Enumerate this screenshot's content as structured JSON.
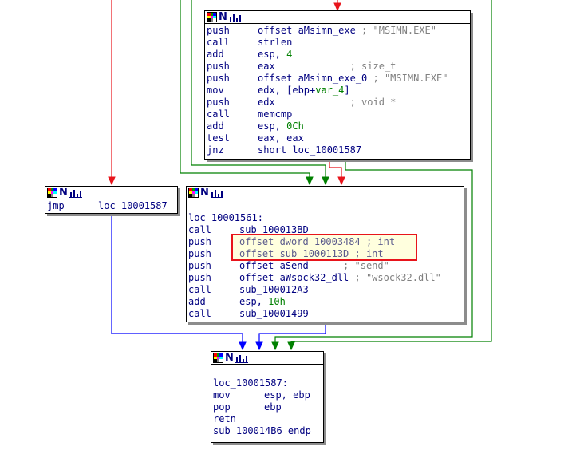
{
  "colors": {
    "instruction": "#000080",
    "number": "#008000",
    "comment": "#808080",
    "edge_red": "#e8141b",
    "edge_green": "#008000",
    "edge_blue": "#0000ff",
    "highlight_border": "#e8141b"
  },
  "header_icons": [
    "color-grid-icon",
    "n-letter-icon",
    "bar-graph-icon"
  ],
  "node_top": {
    "lines": [
      {
        "mn": "push",
        "op": "offset aMsimn_exe",
        "cm": " ; \"MSIMN.EXE\""
      },
      {
        "mn": "call",
        "op": "strlen"
      },
      {
        "mn": "add",
        "op": "esp, ",
        "num": "4"
      },
      {
        "mn": "push",
        "op": "eax",
        "cm": "             ; size_t"
      },
      {
        "mn": "push",
        "op": "offset aMsimn_exe_0",
        "cm": " ; \"MSIMN.EXE\""
      },
      {
        "mn": "mov",
        "op": "edx, [ebp+",
        "var": "var_4",
        "op2": "]"
      },
      {
        "mn": "push",
        "op": "edx",
        "cm": "             ; void *"
      },
      {
        "mn": "call",
        "op": "memcmp"
      },
      {
        "mn": "add",
        "op": "esp, ",
        "num": "0Ch"
      },
      {
        "mn": "test",
        "op": "eax, eax"
      },
      {
        "mn": "jnz",
        "op": "short loc_10001587"
      }
    ]
  },
  "node_left": {
    "lines": [
      {
        "mn": "jmp",
        "op": "loc_10001587"
      }
    ]
  },
  "node_mid": {
    "label": "loc_10001561:",
    "lines": [
      {
        "mn": "call",
        "op": "sub_100013BD"
      },
      {
        "mn": "push",
        "op": "offset dword_10003484 ; int"
      },
      {
        "mn": "push",
        "op": "offset sub_1000113D ; int"
      },
      {
        "mn": "push",
        "op": "offset aSend",
        "cm": "      ; \"send\""
      },
      {
        "mn": "push",
        "op": "offset aWsock32_dll",
        "cm": " ; \"wsock32.dll\""
      },
      {
        "mn": "call",
        "op": "sub_100012A3"
      },
      {
        "mn": "add",
        "op": "esp, ",
        "num": "10h"
      },
      {
        "mn": "call",
        "op": "sub_10001499"
      }
    ]
  },
  "node_bottom": {
    "label": "loc_10001587:",
    "lines": [
      {
        "mn": "mov",
        "op": "esp, ebp"
      },
      {
        "mn": "pop",
        "op": "ebp"
      },
      {
        "mn": "retn",
        "op": ""
      }
    ],
    "endp": "sub_100014B6 endp"
  }
}
